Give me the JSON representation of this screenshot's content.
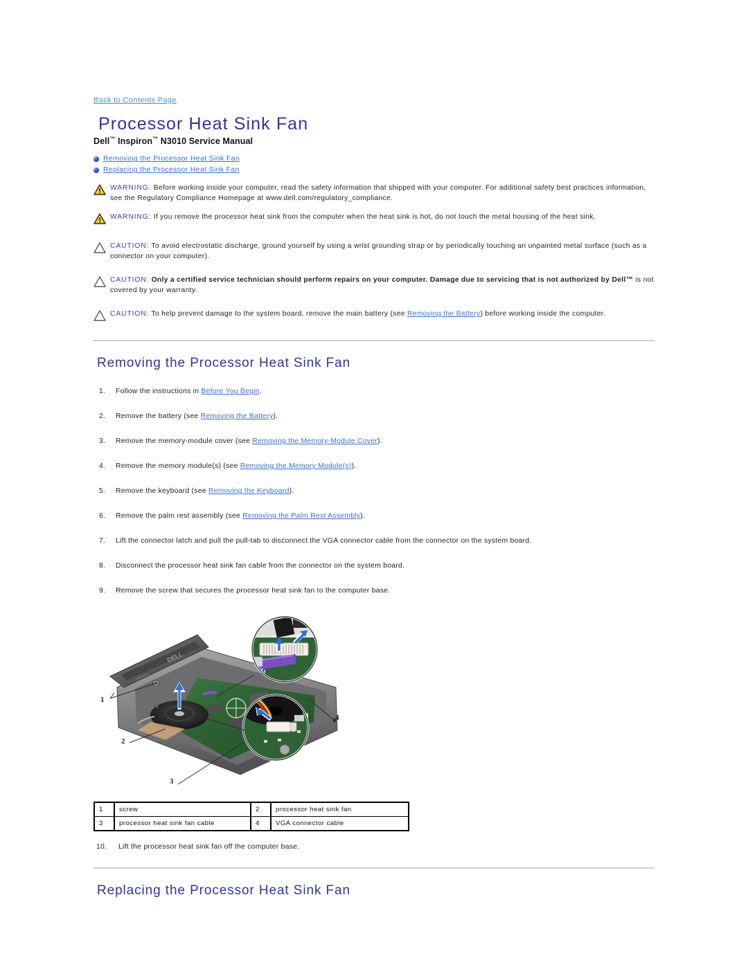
{
  "page": {
    "back_link": "Back to Contents Page",
    "title": "Processor Heat Sink Fan",
    "subtitle_pre": "Dell",
    "subtitle_tm1": "™",
    "subtitle_mid": " Inspiron",
    "subtitle_tm2": "™",
    "subtitle_post": " N3010 Service Manual"
  },
  "toc": {
    "items": [
      {
        "label": "Removing the Processor Heat Sink Fan"
      },
      {
        "label": "Replacing the Processor Heat Sink Fan"
      }
    ]
  },
  "notices": [
    {
      "type": "warning",
      "label": "WARNING:",
      "text": " Before working inside your computer, read the safety information that shipped with your computer. For additional safety best practices information, see the Regulatory Compliance Homepage at www.dell.com/regulatory_compliance."
    },
    {
      "type": "warning",
      "label": "WARNING:",
      "text": " If you remove the processor heat sink from the computer when the heat sink is hot, do not touch the metal housing of the heat sink."
    },
    {
      "type": "caution",
      "label": "CAUTION:",
      "text": " To avoid electrostatic discharge, ground yourself by using a wrist grounding strap or by periodically touching an unpainted metal surface (such as a connector on your computer)."
    },
    {
      "type": "caution",
      "label": "CAUTION:",
      "bold_text": " Only a certified service technician should perform repairs on your computer. Damage due to servicing that is not authorized by Dell™",
      "text": " is not covered by your warranty."
    },
    {
      "type": "caution",
      "label": "CAUTION:",
      "text_before_link": " To help prevent damage to the system board, remove the main battery (see ",
      "link": "Removing the Battery",
      "text_after_link": ") before working inside the computer."
    }
  ],
  "removing": {
    "heading": "Removing the Processor Heat Sink Fan",
    "steps": [
      {
        "before": "Follow the instructions in ",
        "link": "Before You Begin",
        "after": "."
      },
      {
        "before": "Remove the battery (see ",
        "link": "Removing the Battery",
        "after": ")."
      },
      {
        "before": "Remove the memory-module cover (see ",
        "link": "Removing the Memory-Module Cover",
        "after": ")."
      },
      {
        "before": "Remove the memory module(s) (see ",
        "link": "Removing the Memory Module(s)",
        "after": ")."
      },
      {
        "before": "Remove the keyboard (see ",
        "link": "Removing the Keyboard",
        "after": ")."
      },
      {
        "before": "Remove the palm rest assembly (see ",
        "link": "Removing the Palm Rest Assembly",
        "after": ")."
      },
      {
        "before": "Lift the connector latch and pull the pull-tab to disconnect the VGA connector cable from the connector on the system board.",
        "link": "",
        "after": ""
      },
      {
        "before": "Disconnect the processor heat sink fan cable from the connector on the system board.",
        "link": "",
        "after": ""
      },
      {
        "before": "Remove the screw that secures the processor heat sink fan to the computer base.",
        "link": "",
        "after": ""
      }
    ],
    "final_step_number": "10.",
    "final_step": "Lift the processor heat sink fan off the computer base."
  },
  "figure": {
    "callouts": [
      {
        "number": "1"
      },
      {
        "number": "2"
      },
      {
        "number": "3"
      },
      {
        "number": "4"
      }
    ],
    "legend_rows": [
      {
        "n1": "1",
        "l1": "screw",
        "n2": "2",
        "l2": "processor heat sink fan"
      },
      {
        "n1": "3",
        "l1": "processor heat sink fan cable",
        "n2": "4",
        "l2": "VGA connector cable"
      }
    ]
  },
  "replacing": {
    "heading": "Replacing the Processor Heat Sink Fan"
  },
  "colors": {
    "heading_blue": "#333399",
    "link_blue": "#3a6fc4",
    "notice_label_blue": "#3b3bc4",
    "warning_yellow": "#f5d029",
    "rule_gray": "#cdcdcd"
  }
}
